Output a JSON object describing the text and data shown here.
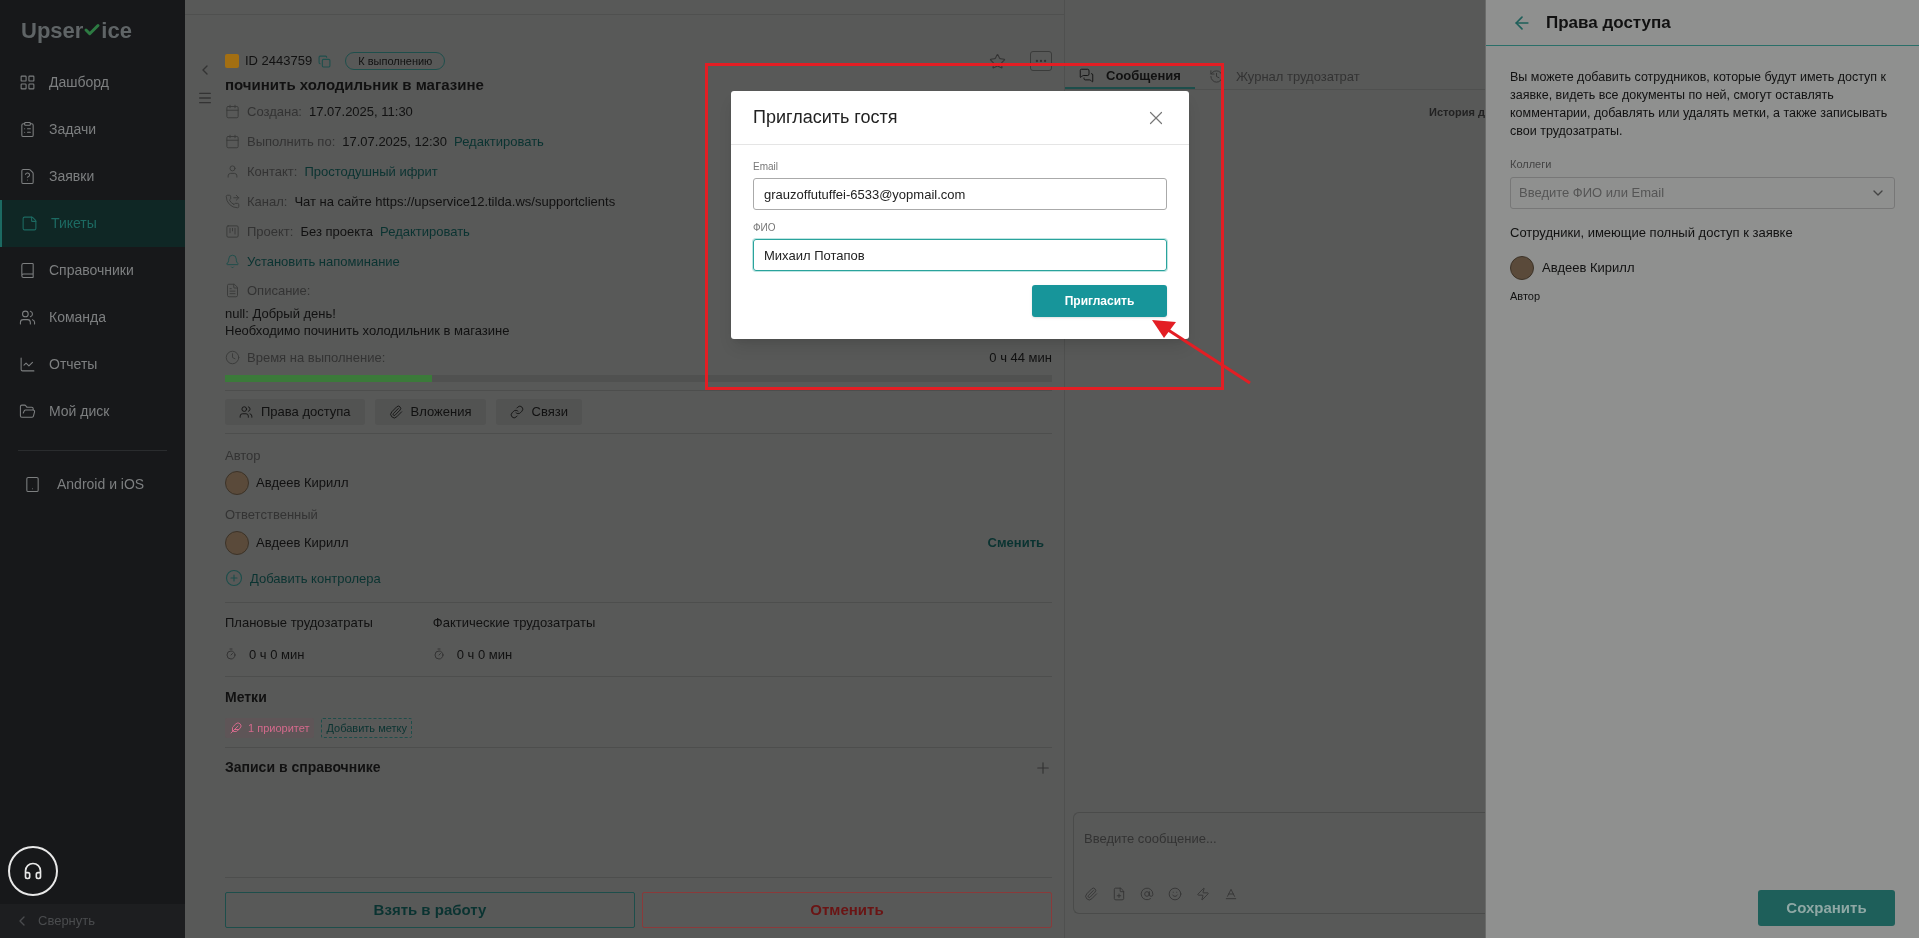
{
  "sidebar": {
    "logo": {
      "before": "Upser",
      "after": "ice"
    },
    "items": [
      {
        "label": "Дашборд",
        "selected": false
      },
      {
        "label": "Задачи",
        "selected": false
      },
      {
        "label": "Заявки",
        "selected": false
      },
      {
        "label": "Тикеты",
        "selected": true
      },
      {
        "label": "Справочники",
        "selected": false
      },
      {
        "label": "Команда",
        "selected": false
      },
      {
        "label": "Отчеты",
        "selected": false
      },
      {
        "label": "Мой диск",
        "selected": false
      }
    ],
    "apps": "Android и iOS",
    "collapse": "Свернуть"
  },
  "ticket": {
    "id": "ID 2443759",
    "status": "К выполнению",
    "title": "починить холодильник в магазине",
    "fields": [
      {
        "label": "Создана:",
        "value": "17.07.2025, 11:30"
      },
      {
        "label": "Выполнить по:",
        "value": "17.07.2025, 12:30",
        "link": "Редактировать"
      },
      {
        "label": "Контакт:",
        "link": "Простодушный ифрит"
      },
      {
        "label": "Канал:",
        "value": "Чат на сайте https://upservice12.tilda.ws/supportclients"
      },
      {
        "label": "Проект:",
        "value": "Без проекта",
        "link": "Редактировать"
      }
    ],
    "reminder": "Установить напоминание",
    "description_label": "Описание:",
    "description": [
      "null: Добрый день!",
      "Необходимо починить холодильник в магазине"
    ],
    "time_label": "Время на выполнение:",
    "time_value": "0 ч 44 мин",
    "level": 0.25,
    "actions": [
      "Права доступа",
      "Вложения",
      "Связи"
    ],
    "author_label": "Автор",
    "author": "Авдеев Кирилл",
    "responsible_label": "Ответственный",
    "responsible": "Авдеев Кирилл",
    "change": "Сменить",
    "add_controller": "Добавить контролера",
    "labor": [
      {
        "label": "Плановые трудозатраты",
        "value": "0 ч 0 мин"
      },
      {
        "label": "Фактические трудозатраты",
        "value": "0 ч 0 мин"
      }
    ],
    "tags_title": "Метки",
    "tags": [
      {
        "label": "1 приоритет",
        "color": "#d46a8c"
      }
    ],
    "add_tag": "Добавить метку",
    "directory_title": "Записи в справочнике",
    "take": "Взять в работу",
    "cancel": "Отменить"
  },
  "chat": {
    "tabs": [
      {
        "label": "Сообщения",
        "selected": true
      },
      {
        "label": "Журнал трудозатрат",
        "selected": false
      }
    ],
    "history": "История д",
    "placeholder": "Введите сообщение..."
  },
  "access_panel": {
    "title": "Права доступа",
    "text": "Вы можете добавить сотрудников, которые будут иметь доступ к заявке, видеть все документы по ней, смогут оставлять комментарии, добавлять или удалять метки, а также записывать свои трудозатраты.",
    "colleagues_label": "Коллеги",
    "colleagues_placeholder": "Введите ФИО или Email",
    "members_title": "Сотрудники, имеющие полный доступ к заявке",
    "members": [
      {
        "name": "Авдеев Кирилл",
        "role": "Автор"
      }
    ],
    "save": "Сохранить"
  },
  "dialog": {
    "title": "Пригласить гостя",
    "fields": [
      {
        "label": "Email",
        "value": "grauzoffutuffei-6533@yopmail.com",
        "focused": false
      },
      {
        "label": "ФИО",
        "value": "Михаил Потапов",
        "focused": true
      }
    ],
    "submit": "Пригласить"
  }
}
